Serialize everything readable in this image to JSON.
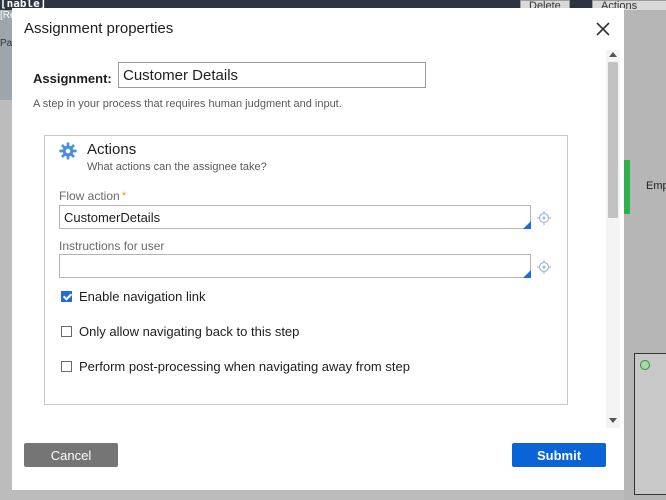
{
  "background": {
    "top_label": "[nable]",
    "top_label2": "[Re",
    "delete_label": "Delete",
    "actions_label": "Actions",
    "sub_label": "Pa",
    "right_label": "Emp"
  },
  "dialog": {
    "title": "Assignment properties",
    "assignment_label": "Assignment:",
    "assignment_value": "Customer Details",
    "assignment_desc": "A step in your process that requires human judgment and input.",
    "actions": {
      "title": "Actions",
      "subtitle": "What actions can the assignee take?",
      "flow_action_label": "Flow action",
      "flow_action_required": "*",
      "flow_action_value": "CustomerDetails",
      "instructions_label": "Instructions for user",
      "instructions_value": "",
      "checkboxes": [
        {
          "label": "Enable navigation link",
          "checked": true
        },
        {
          "label": "Only allow navigating back to this step",
          "checked": false
        },
        {
          "label": "Perform post-processing when navigating away from step",
          "checked": false
        }
      ]
    },
    "buttons": {
      "cancel": "Cancel",
      "submit": "Submit"
    }
  },
  "colors": {
    "primary": "#0a64d8",
    "secondary_button": "#757575",
    "required_star": "#f0a020"
  },
  "icons": [
    "close-icon",
    "gear-icon",
    "target-icon"
  ]
}
